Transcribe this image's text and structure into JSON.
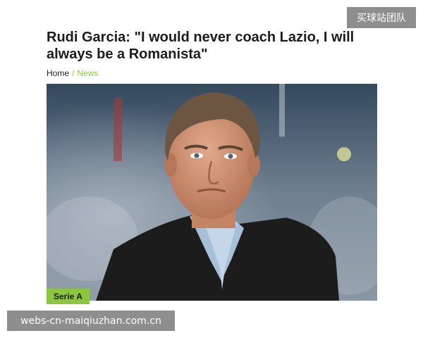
{
  "watermarks": {
    "top": "买球站团队",
    "bottom": "webs-cn-maiqiuzhan.com.cn"
  },
  "article": {
    "title": "Rudi Garcia: \"I would never coach Lazio, I will always be a Romanista\"",
    "breadcrumb": {
      "home": "Home",
      "separator": "/",
      "current": "News"
    },
    "category_tag": "Serie A"
  },
  "colors": {
    "accent": "#8cc63f",
    "watermark_bg": "#8e8e8e"
  }
}
